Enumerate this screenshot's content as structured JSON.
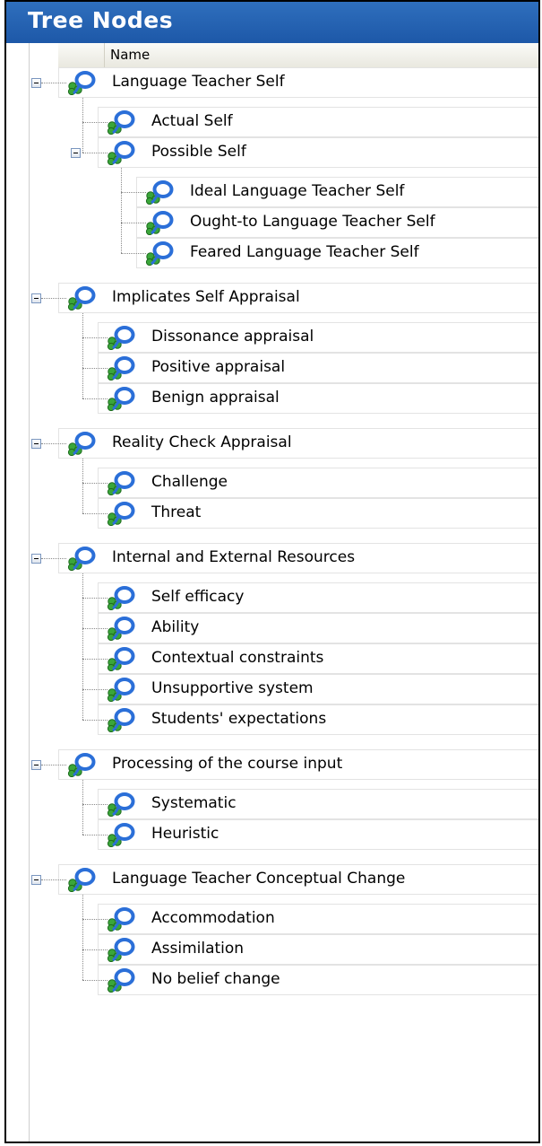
{
  "panel": {
    "title": "Tree Nodes",
    "column_header": "Name"
  },
  "tree": [
    {
      "label": "Language Teacher Self",
      "level": 0,
      "expanded": true
    },
    {
      "label": "Actual Self",
      "level": 1
    },
    {
      "label": "Possible Self",
      "level": 1,
      "expanded": true
    },
    {
      "label": "Ideal Language Teacher Self",
      "level": 2
    },
    {
      "label": "Ought-to Language Teacher Self",
      "level": 2
    },
    {
      "label": "Feared Language Teacher Self",
      "level": 2
    },
    {
      "label": "Implicates Self Appraisal",
      "level": 0,
      "expanded": true
    },
    {
      "label": "Dissonance appraisal",
      "level": 1
    },
    {
      "label": "Positive appraisal",
      "level": 1
    },
    {
      "label": "Benign appraisal",
      "level": 1
    },
    {
      "label": "Reality Check Appraisal",
      "level": 0,
      "expanded": true
    },
    {
      "label": "Challenge",
      "level": 1
    },
    {
      "label": "Threat",
      "level": 1
    },
    {
      "label": "Internal and External Resources",
      "level": 0,
      "expanded": true
    },
    {
      "label": "Self efficacy",
      "level": 1
    },
    {
      "label": "Ability",
      "level": 1
    },
    {
      "label": "Contextual constraints",
      "level": 1
    },
    {
      "label": "Unsupportive system",
      "level": 1
    },
    {
      "label": "Students' expectations",
      "level": 1
    },
    {
      "label": "Processing of the course input",
      "level": 0,
      "expanded": true
    },
    {
      "label": "Systematic",
      "level": 1
    },
    {
      "label": "Heuristic",
      "level": 1
    },
    {
      "label": "Language Teacher Conceptual Change",
      "level": 0,
      "expanded": true
    },
    {
      "label": "Accommodation",
      "level": 1
    },
    {
      "label": "Assimilation",
      "level": 1
    },
    {
      "label": "No belief change",
      "level": 1
    }
  ],
  "colors": {
    "titlebar": "#2166b4",
    "title_text": "#ffffff",
    "icon_blue": "#2b6fd8",
    "icon_green": "#3aa63a"
  },
  "icons": {
    "node": "node-users-icon",
    "toggle": "collapse-minus-icon"
  }
}
